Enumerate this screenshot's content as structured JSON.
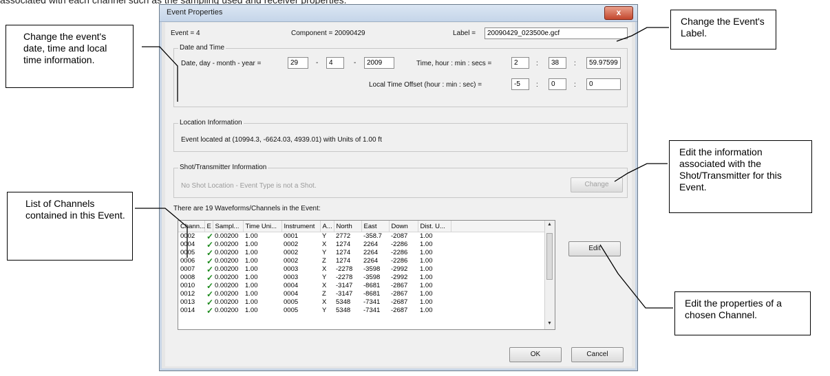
{
  "top_text": "associated with each channel such as the sampling used and receiver properties.",
  "callouts": {
    "date_time": "Change the event's date, time and local time information.",
    "label": "Change the Event's Label.",
    "channels": "List of Channels contained in this Event.",
    "shot": "Edit the information associated with the Shot/Transmitter for this Event.",
    "edit": "Edit the properties of a chosen Channel."
  },
  "window": {
    "title": "Event Properties",
    "close_glyph": "x"
  },
  "header": {
    "event": "Event = 4",
    "component": "Component = 20090429",
    "label_caption": "Label =",
    "label_value": "20090429_023500e.gcf"
  },
  "date_time": {
    "group_label": "Date and Time",
    "date_caption": "Date, day - month - year =",
    "day": "29",
    "month": "4",
    "year": "2009",
    "dash": "-",
    "time_caption": "Time, hour : min : secs =",
    "hour": "2",
    "minute": "38",
    "second": "59.97599",
    "colon": ":",
    "offset_caption": "Local Time Offset (hour : min : sec) =",
    "offset_hour": "-5",
    "offset_min": "0",
    "offset_sec": "0"
  },
  "location": {
    "group_label": "Location Information",
    "text": "Event located at (10994.3, -6624.03, 4939.01) with Units of 1.00 ft"
  },
  "shot": {
    "group_label": "Shot/Transmitter Information",
    "text": "No Shot Location - Event Type is not a Shot.",
    "change_label": "Change"
  },
  "channels": {
    "summary": "There are 19 Waveforms/Channels in the Event:",
    "columns": [
      "Chann...",
      "E",
      "Sampl...",
      "Time Uni...",
      "Instrument",
      "A...",
      "North",
      "East",
      "Down",
      "Dist. U..."
    ],
    "rows": [
      [
        "0002",
        "✓",
        "0.00200",
        "1.00",
        "0001",
        "Y",
        "2772",
        "-358.7",
        "-2087",
        "1.00"
      ],
      [
        "0004",
        "✓",
        "0.00200",
        "1.00",
        "0002",
        "X",
        "1274",
        "2264",
        "-2286",
        "1.00"
      ],
      [
        "0005",
        "✓",
        "0.00200",
        "1.00",
        "0002",
        "Y",
        "1274",
        "2264",
        "-2286",
        "1.00"
      ],
      [
        "0006",
        "✓",
        "0.00200",
        "1.00",
        "0002",
        "Z",
        "1274",
        "2264",
        "-2286",
        "1.00"
      ],
      [
        "0007",
        "✓",
        "0.00200",
        "1.00",
        "0003",
        "X",
        "-2278",
        "-3598",
        "-2992",
        "1.00"
      ],
      [
        "0008",
        "✓",
        "0.00200",
        "1.00",
        "0003",
        "Y",
        "-2278",
        "-3598",
        "-2992",
        "1.00"
      ],
      [
        "0010",
        "✓",
        "0.00200",
        "1.00",
        "0004",
        "X",
        "-3147",
        "-8681",
        "-2867",
        "1.00"
      ],
      [
        "0012",
        "✓",
        "0.00200",
        "1.00",
        "0004",
        "Z",
        "-3147",
        "-8681",
        "-2867",
        "1.00"
      ],
      [
        "0013",
        "✓",
        "0.00200",
        "1.00",
        "0005",
        "X",
        "5348",
        "-7341",
        "-2687",
        "1.00"
      ],
      [
        "0014",
        "✓",
        "0.00200",
        "1.00",
        "0005",
        "Y",
        "5348",
        "-7341",
        "-2687",
        "1.00"
      ]
    ],
    "edit_label": "Edit"
  },
  "footer": {
    "ok_label": "OK",
    "cancel_label": "Cancel"
  }
}
